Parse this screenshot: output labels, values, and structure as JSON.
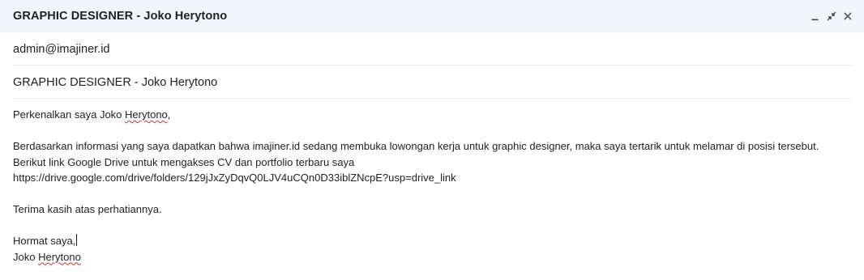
{
  "window": {
    "title": "GRAPHIC DESIGNER - Joko Herytono",
    "controls": [
      "minimize-icon",
      "exit-fullscreen-icon",
      "close-icon"
    ]
  },
  "recipient": {
    "value": "admin@imajiner.id"
  },
  "subject": {
    "value": "GRAPHIC DESIGNER - Joko Herytono"
  },
  "body": {
    "greeting_prefix": "Perkenalkan saya Joko ",
    "greeting_name": "Herytono",
    "greeting_suffix": ",",
    "line1": "Berdasarkan informasi yang saya dapatkan bahwa imajiner.id sedang membuka lowongan kerja untuk graphic designer, maka saya tertarik untuk melamar di posisi tersebut.",
    "line2": "Berikut link Google Drive untuk mengakses CV dan portfolio terbaru saya",
    "link": "https://drive.google.com/drive/folders/129jJxZyDqvQ0LJV4uCQn0D33iblZNcpE?usp=drive_link",
    "thanks": "Terima kasih atas perhatiannya.",
    "closing": "Hormat saya,",
    "signature_prefix": "Joko ",
    "signature_name": "Herytono"
  },
  "colors": {
    "titlebar_bg": "#f2f6fc",
    "spellcheck": "#d93025"
  }
}
